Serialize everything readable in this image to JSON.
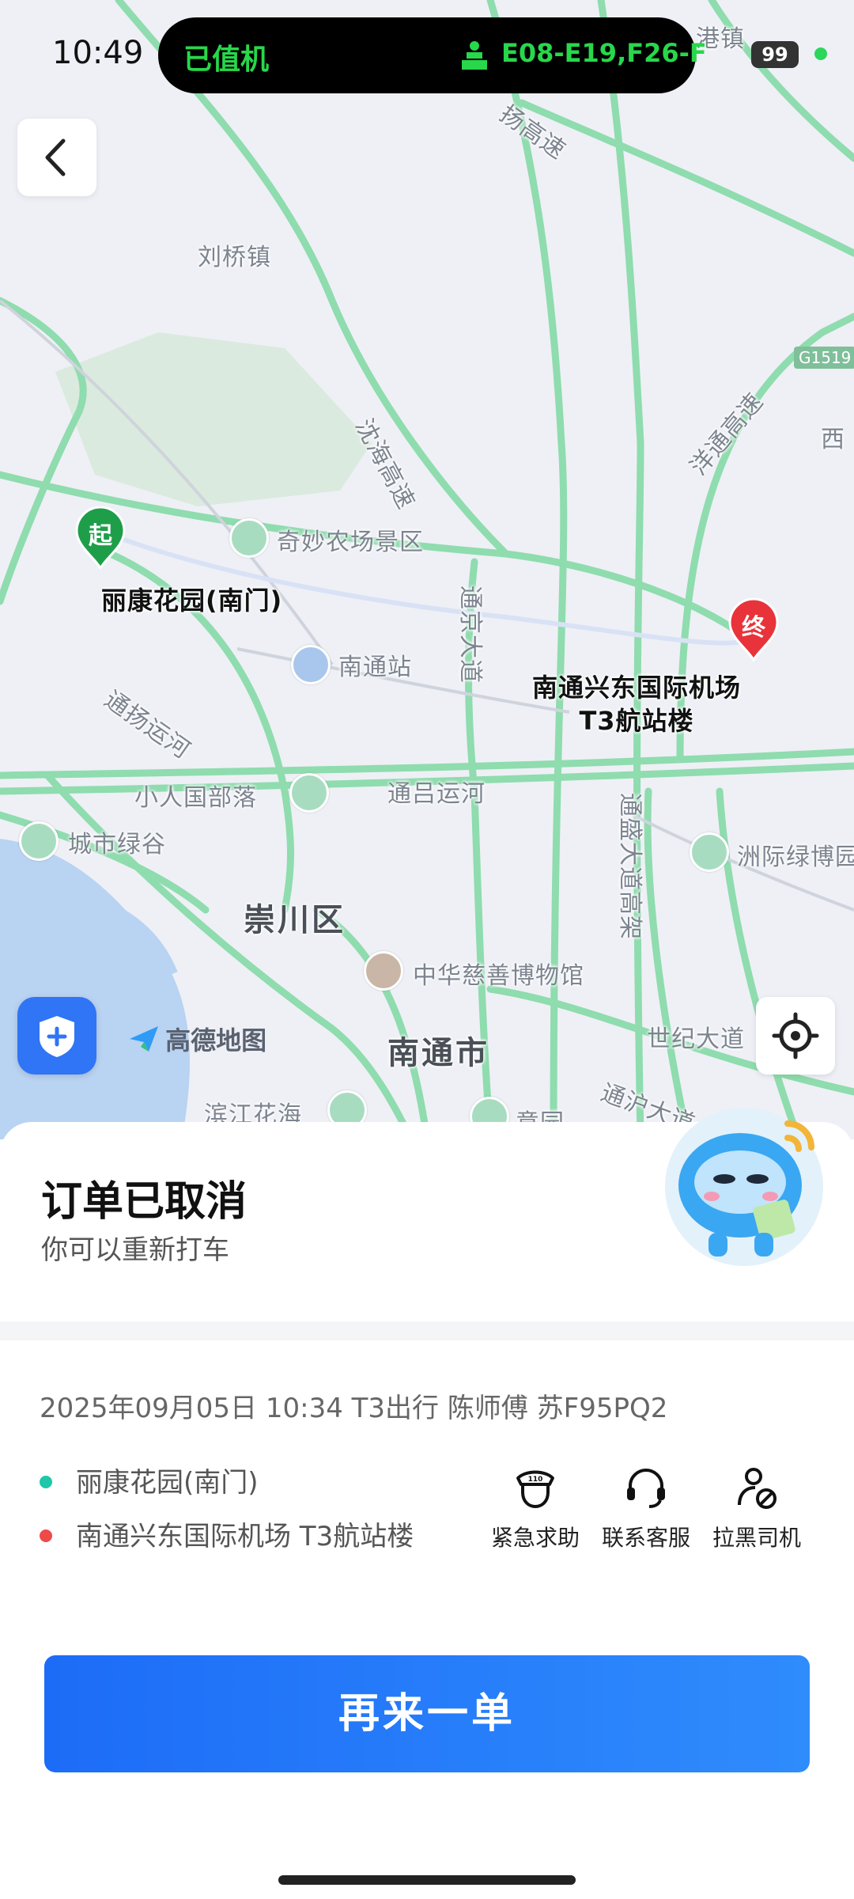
{
  "status_bar": {
    "time": "10:49",
    "island_left": "已值机",
    "island_right": "E08-E19,F26-F",
    "battery": "99",
    "indicator_color": "#2bd65a"
  },
  "map": {
    "attribution": "高德地图",
    "labels": {
      "liuqiao": "刘桥镇",
      "shenhai": "沈海高速",
      "qimiao": "奇妙农场景区",
      "nantong_station": "南通站",
      "tongjing": "通京大道",
      "tongyang": "通扬运河",
      "xiaoren": "小人国部落",
      "tonglv": "通吕运河",
      "chengshi": "城市绿谷",
      "chongchuan": "崇川区",
      "zhonghua": "中华慈善博物馆",
      "nantong_city": "南通市",
      "binjiang": "滨江花海",
      "yiyuan": "意园",
      "shiji": "世纪大道",
      "tonghu": "通沪大道",
      "tongsheng": "通盛大道高架",
      "zhouji": "洲际绿博园",
      "yangtong": "洋通高速",
      "g1519": "G1519",
      "xi": "西",
      "gang": "港镇",
      "yang_exp": "扬高速"
    },
    "start": {
      "badge": "起",
      "name": "丽康花园(南门)"
    },
    "end": {
      "badge": "终",
      "name_line1": "南通兴东国际机场",
      "name_line2": "T3航站楼"
    },
    "icons": {
      "back": "back-arrow-icon",
      "safety": "shield-plus-icon",
      "locate": "locate-crosshair-icon"
    },
    "colors": {
      "road": "#8fdcae",
      "start": "#1f9e4a",
      "end": "#e8333a",
      "water": "#b9d3f2"
    }
  },
  "order": {
    "title": "订单已取消",
    "subtitle": "你可以重新打车",
    "info": "2025年09月05日 10:34 T3出行 陈师傅 苏F95PQ2",
    "from": "丽康花园(南门)",
    "to": "南通兴东国际机场 T3航站楼",
    "from_color": "#1fc7a8",
    "to_color": "#ee4a4a"
  },
  "actions": [
    {
      "label": "紧急求助",
      "icon": "police-110-icon"
    },
    {
      "label": "联系客服",
      "icon": "headset-icon"
    },
    {
      "label": "拉黑司机",
      "icon": "block-user-icon"
    }
  ],
  "reorder_button": "再来一单"
}
